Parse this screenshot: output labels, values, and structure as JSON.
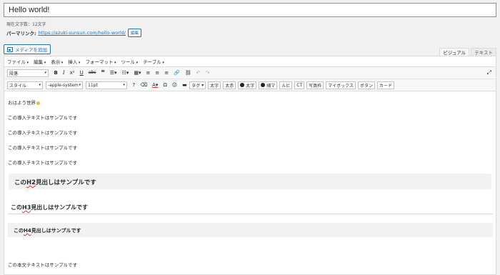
{
  "title": "Hello world!",
  "char_count": "現在文字数：12文字",
  "permalink": {
    "label": "パーマリンク:",
    "url": "https://azuki-sunsun.com/hello-world/",
    "edit": "編集"
  },
  "media_button": "メディアを追加",
  "mode_tabs": [
    "ビジュアル",
    "テキスト"
  ],
  "menubar": [
    "ファイル",
    "編集",
    "表示",
    "挿入",
    "フォーマット",
    "ツール",
    "テーブル"
  ],
  "toolbar1": {
    "format_select": "段落"
  },
  "toolbar2": {
    "style_select": "スタイル",
    "font_select": "-apple-system",
    "size_select": "11pt",
    "buttons": [
      "タグ",
      "太字",
      "太赤",
      "太字",
      "細マ",
      "ルビ",
      "CT",
      "写真枠",
      "マイボックス",
      "ボタン",
      "カード"
    ]
  },
  "content": {
    "greeting": "おはよう世界",
    "paragraphs": [
      "この導入テキストはサンプルです",
      "この導入テキストはサンプルです",
      "この導入テキストはサンプルです",
      "この導入テキストはサンプルです"
    ],
    "h2": {
      "pre": "この",
      "mid": "H2",
      "post": "見出しはサンプルです"
    },
    "h3": {
      "pre": "この",
      "mid": "H3",
      "post": "見出しはサンプルです"
    },
    "h4": {
      "pre": "この",
      "mid": "H4",
      "post": "見出しはサンプルです"
    },
    "body": "この本文テキストはサンプルです"
  }
}
